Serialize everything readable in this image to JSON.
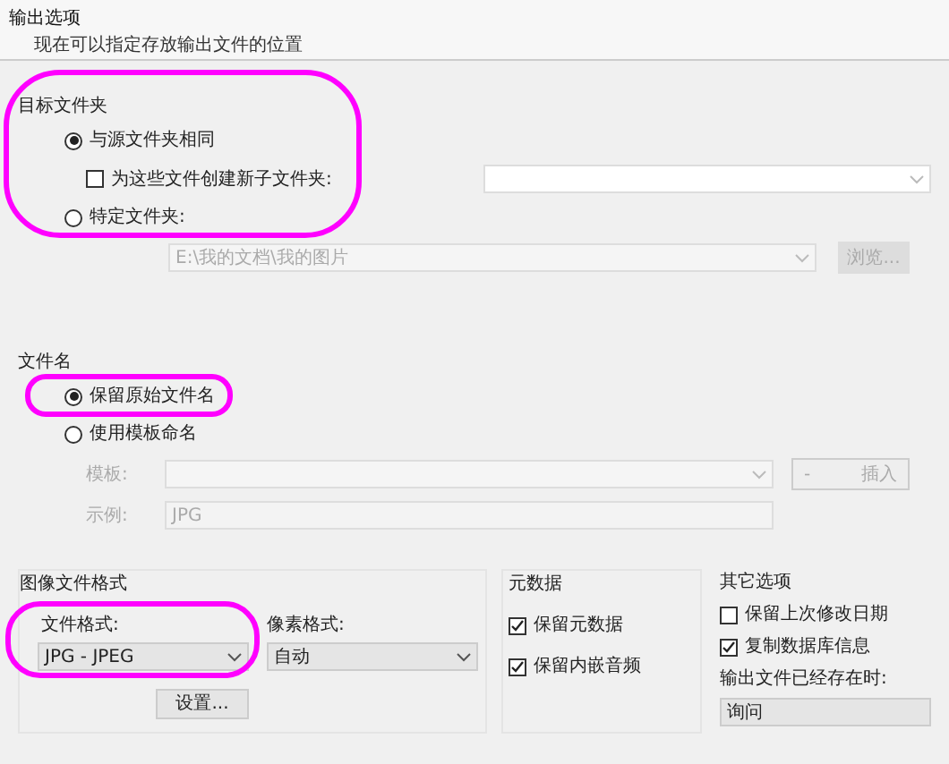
{
  "header": {
    "title": "输出选项",
    "subtitle": "现在可以指定存放输出文件的位置"
  },
  "destination": {
    "label": "目标文件夹",
    "options": [
      {
        "label": "与源文件夹相同",
        "selected": true
      },
      {
        "label": "特定文件夹:",
        "selected": false
      }
    ],
    "subfolder": {
      "label": "为这些文件创建新子文件夹:",
      "checked": false
    },
    "folder_path": {
      "value": "E:\\我的文档\\我的图片",
      "disabled": true
    },
    "browse_button": {
      "label": "浏览...",
      "disabled": true
    }
  },
  "filename": {
    "label": "文件名",
    "options": [
      {
        "label": "保留原始文件名",
        "selected": true
      },
      {
        "label": "使用模板命名",
        "selected": false
      }
    ],
    "template": {
      "label": "模板:",
      "disabled": true
    },
    "minus_button": "-",
    "insert_button": {
      "label": "插入",
      "disabled": true
    },
    "example": {
      "label": "示例:",
      "value": "JPG"
    }
  },
  "image_format": {
    "label": "图像文件格式",
    "file_format_label": "文件格式:",
    "file_format": "JPG - JPEG",
    "pixel_format_label": "像素格式:",
    "pixel_format": "自动",
    "settings_button": "设置..."
  },
  "metadata": {
    "label": "元数据",
    "items": [
      {
        "label": "保留元数据",
        "checked": true
      },
      {
        "label": "保留内嵌音频",
        "checked": true
      }
    ]
  },
  "other": {
    "label": "其它选项",
    "items": [
      {
        "label": "保留上次修改日期",
        "checked": false
      },
      {
        "label": "复制数据库信息",
        "checked": true
      }
    ],
    "exists_label": "输出文件已经存在时:",
    "exists_value": "询问"
  }
}
